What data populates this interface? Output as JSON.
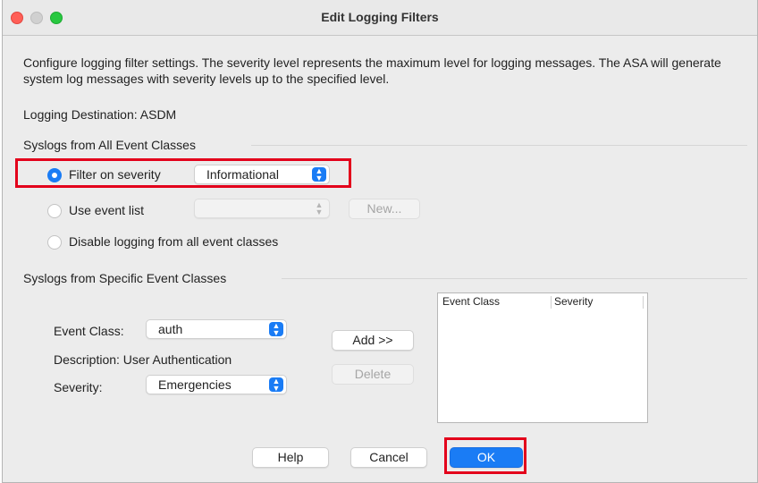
{
  "window": {
    "title": "Edit Logging Filters"
  },
  "description": "Configure logging filter settings. The severity level represents the maximum level for logging messages. The ASA will generate system log messages with severity levels up to the specified level.",
  "destination": {
    "label": "Logging Destination: ASDM"
  },
  "all_classes": {
    "heading": "Syslogs from All Event Classes",
    "filter_severity": {
      "label": "Filter on severity",
      "selected": "Informational",
      "checked": true
    },
    "event_list": {
      "label": "Use event list",
      "selected": "",
      "new_label": "New..."
    },
    "disable": {
      "label": "Disable logging from all event classes"
    }
  },
  "specific_classes": {
    "heading": "Syslogs from Specific Event Classes",
    "event_class_label": "Event Class:",
    "event_class_value": "auth",
    "description_label": "Description: User Authentication",
    "severity_label": "Severity:",
    "severity_value": "Emergencies",
    "add_label": "Add >>",
    "delete_label": "Delete",
    "table": {
      "columns": [
        "Event Class",
        "Severity"
      ],
      "rows": []
    }
  },
  "footer": {
    "help_label": "Help",
    "cancel_label": "Cancel",
    "ok_label": "OK"
  },
  "colors": {
    "accent": "#1a7cf5",
    "highlight": "#e3001b"
  }
}
